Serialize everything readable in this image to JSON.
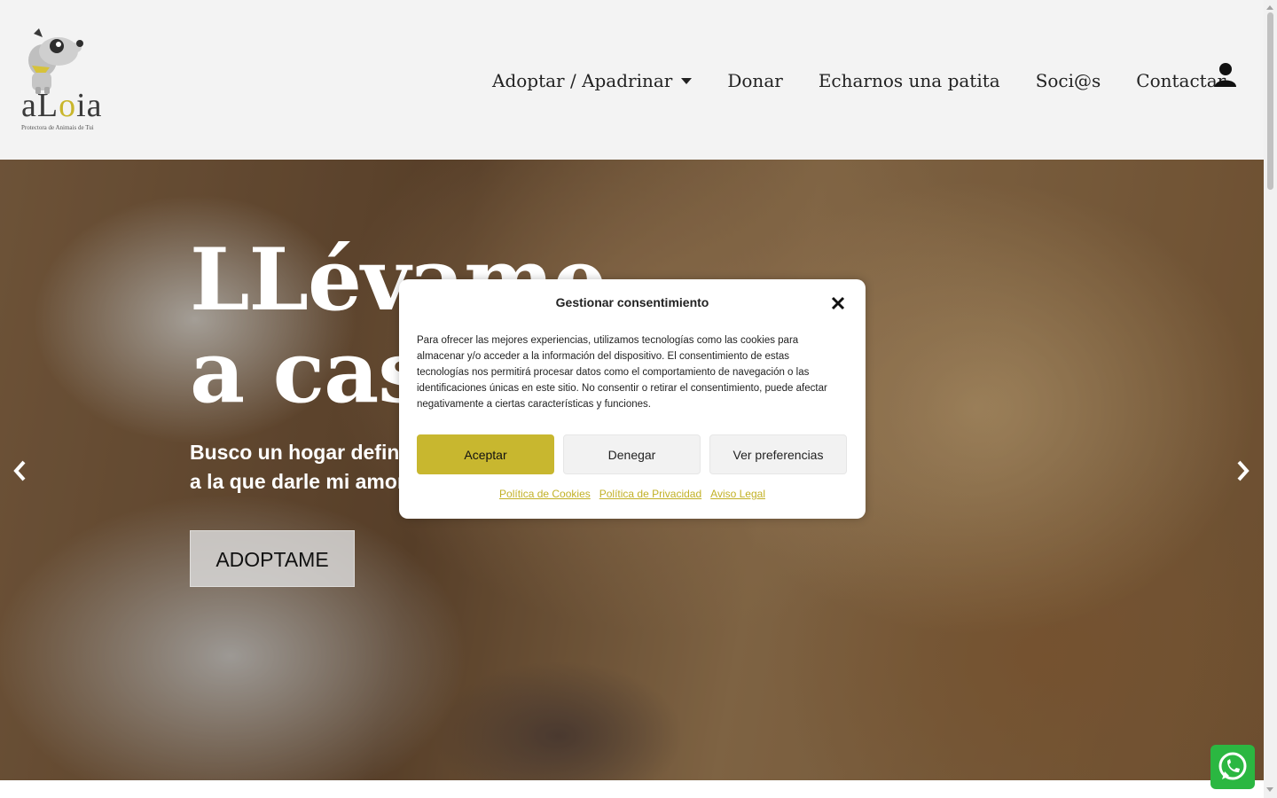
{
  "brand": {
    "logo_text_a": "aL",
    "logo_text_o": "o",
    "logo_text_b": "ia",
    "tagline": "Protectora de Animais de Tui",
    "accent_color": "#c8b72f"
  },
  "nav": {
    "items": [
      {
        "label": "Adoptar / Apadrinar",
        "has_dropdown": true
      },
      {
        "label": "Donar"
      },
      {
        "label": "Echarnos una patita"
      },
      {
        "label": "Soci@s"
      },
      {
        "label": "Contactar"
      }
    ],
    "account_icon": "user-icon"
  },
  "hero": {
    "title_line1": "LLévame",
    "title_line2": "a casa",
    "subtitle_line1": "Busco un hogar definitivo y una familia",
    "subtitle_line2": "a la que darle mi amor",
    "button": "ADOPTAME",
    "prev_icon": "chevron-left-icon",
    "next_icon": "chevron-right-icon"
  },
  "consent": {
    "title": "Gestionar consentimiento",
    "body": "Para ofrecer las mejores experiencias, utilizamos tecnologías como las cookies para almacenar y/o acceder a la información del dispositivo. El consentimiento de estas tecnologías nos permitirá procesar datos como el comportamiento de navegación o las identificaciones únicas en este sitio. No consentir o retirar el consentimiento, puede afectar negativamente a ciertas características y funciones.",
    "accept": "Aceptar",
    "deny": "Denegar",
    "preferences": "Ver preferencias",
    "links": [
      "Política de Cookies",
      "Política de Privacidad",
      "Aviso Legal"
    ]
  },
  "whatsapp": {
    "icon": "whatsapp-icon",
    "color": "#2bb741"
  }
}
